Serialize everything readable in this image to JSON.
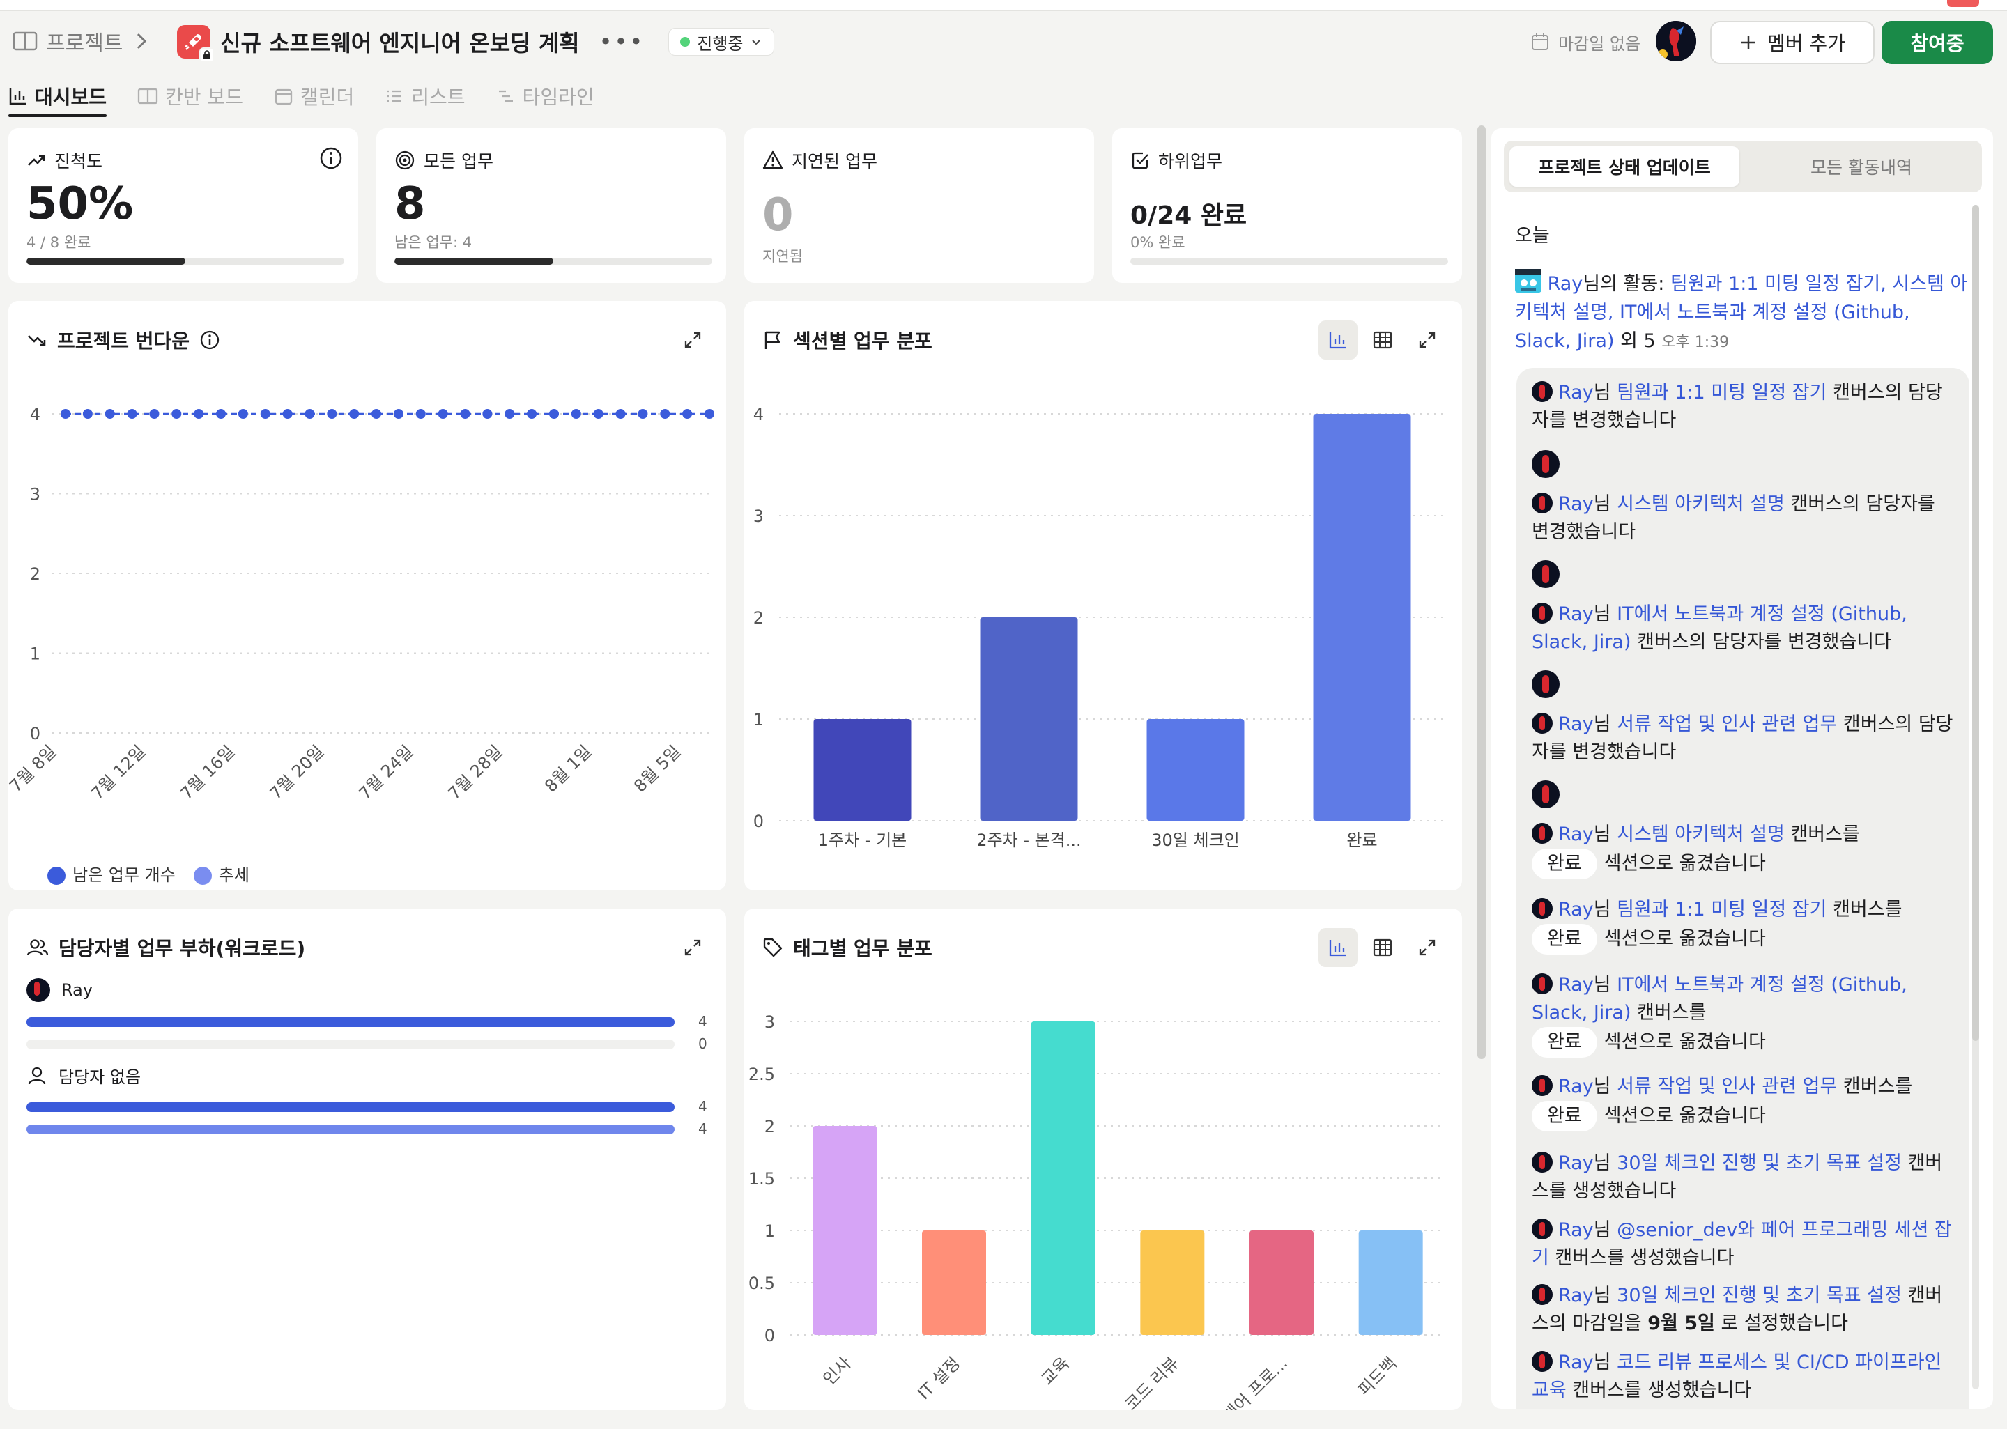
{
  "header": {
    "breadcrumb": "프로젝트",
    "title": "신규 소프트웨어 엔지니어 온보딩 계획",
    "status": "진행중",
    "due": "마감일 없음",
    "add_member": "멤버 추가",
    "join": "참여중"
  },
  "tabs": [
    {
      "label": "대시보드",
      "icon": "chart-icon"
    },
    {
      "label": "칸반 보드",
      "icon": "kanban-icon"
    },
    {
      "label": "캘린더",
      "icon": "calendar-icon"
    },
    {
      "label": "리스트",
      "icon": "list-icon"
    },
    {
      "label": "타임라인",
      "icon": "timeline-icon"
    }
  ],
  "stats": {
    "progress": {
      "title": "진척도",
      "value": "50%",
      "sub": "4 / 8 완료",
      "fraction": 0.5
    },
    "all_tasks": {
      "title": "모든 업무",
      "value": "8",
      "sub": "남은 업무: 4",
      "fraction": 0.5
    },
    "overdue": {
      "title": "지연된 업무",
      "value": "0",
      "sub": "지연됨"
    },
    "subtasks": {
      "title": "하위업무",
      "value": "0/24 완료",
      "sub": "0% 완료",
      "fraction": 0
    }
  },
  "burndown": {
    "title": "프로젝트 번다운",
    "legend": [
      "남은 업무 개수",
      "추세"
    ]
  },
  "section_chart": {
    "title": "섹션별 업무 분포"
  },
  "workload": {
    "title": "담당자별 업무 부하(워크로드)",
    "people": [
      {
        "name": "Ray",
        "a": "4",
        "b": "0",
        "fa": 1.0,
        "fb": 0
      },
      {
        "name": "담당자 없음",
        "a": "4",
        "b": "4",
        "fa": 1.0,
        "fb": 1.0
      }
    ]
  },
  "tag_chart": {
    "title": "태그별 업무 분포"
  },
  "chart_data": [
    {
      "type": "line",
      "x": [
        "7월 8일",
        "7월 12일",
        "7월 16일",
        "7월 20일",
        "7월 24일",
        "7월 28일",
        "8월 1일",
        "8월 5일"
      ],
      "series": [
        {
          "name": "남은 업무 개수",
          "values": [
            4,
            4,
            4,
            4,
            4,
            4,
            4,
            4,
            4,
            4,
            4,
            4,
            4,
            4,
            4,
            4,
            4,
            4,
            4,
            4,
            4,
            4,
            4,
            4,
            4,
            4,
            4,
            4,
            4,
            4
          ]
        }
      ],
      "yticks": [
        "0",
        "1",
        "2",
        "3",
        "4"
      ],
      "ylim": [
        0,
        4
      ]
    },
    {
      "type": "bar",
      "categories": [
        "1주차 - 기본",
        "2주차 - 본격...",
        "30일 체크인",
        "완료"
      ],
      "values": [
        1,
        2,
        1,
        4
      ],
      "colors": [
        "#4147b9",
        "#5064c8",
        "#5a78e8",
        "#5f7be6"
      ],
      "yticks": [
        "0",
        "1",
        "2",
        "3",
        "4"
      ],
      "ylim": [
        0,
        4
      ]
    },
    {
      "type": "bar",
      "categories": [
        "인사",
        "IT 설정",
        "교육",
        "코드 리뷰",
        "페어 프로...",
        "피드백"
      ],
      "values": [
        2,
        1,
        3,
        1,
        1,
        1
      ],
      "colors": [
        "#d6a4f6",
        "#ff8f78",
        "#45dccf",
        "#fbc64f",
        "#e56683",
        "#86c0f5"
      ],
      "yticks": [
        "0",
        "0.5",
        "1",
        "1.5",
        "2",
        "2.5",
        "3"
      ],
      "ylim": [
        0,
        3
      ]
    }
  ],
  "panel": {
    "tab_active": "프로젝트 상태 업데이트",
    "tab_other": "모든 활동내역",
    "today": "오늘",
    "head_user": "Ray",
    "head_mid": "님의 활동: ",
    "head_links": "팀원과 1:1 미팅 일정 잡기, 시스템 아키텍처 설명, IT에서 노트북과 계정 설정 (Github, Slack, Jira)",
    "head_more": " 외 5 ",
    "head_time": "오후 1:39",
    "events": [
      {
        "user": "Ray",
        "mid": "님 ",
        "link": "팀원과 1:1 미팅 일정 잡기",
        "rest": " 캔버스의 담당자를 변경했습니다"
      },
      {
        "user": "Ray",
        "mid": "님 ",
        "link": "시스템 아키텍처 설명",
        "rest": " 캔버스의 담당자를 변경했습니다"
      },
      {
        "user": "Ray",
        "mid": "님 ",
        "link": "IT에서 노트북과 계정 설정 (Github, Slack, Jira)",
        "rest": " 캔버스의 담당자를 변경했습니다"
      },
      {
        "user": "Ray",
        "mid": "님 ",
        "link": "서류 작업 및 인사 관련 업무",
        "rest": " 캔버스의 담당자를 변경했습니다"
      },
      {
        "user": "Ray",
        "mid": "님 ",
        "link": "시스템 아키텍처 설명",
        "rest": " 캔버스를",
        "pill": "완료",
        "after": "섹션으로 옮겼습니다"
      },
      {
        "user": "Ray",
        "mid": "님 ",
        "link": "팀원과 1:1 미팅 일정 잡기",
        "rest": " 캔버스를",
        "pill": "완료",
        "after": "섹션으로 옮겼습니다"
      },
      {
        "user": "Ray",
        "mid": "님 ",
        "link": "IT에서 노트북과 계정 설정 (Github, Slack, Jira)",
        "rest": " 캔버스를 ",
        "pill": "완료",
        "after": "섹션으로 옮겼습니다"
      },
      {
        "user": "Ray",
        "mid": "님 ",
        "link": "서류 작업 및 인사 관련 업무",
        "rest": " 캔버스를",
        "pill": "완료",
        "after": "섹션으로 옮겼습니다"
      },
      {
        "user": "Ray",
        "mid": "님 ",
        "link": "30일 체크인 진행 및 초기 목표 설정",
        "rest": " 캔버스를 생성했습니다"
      },
      {
        "user": "Ray",
        "mid": "님 ",
        "link": "@senior_dev와 페어 프로그래밍 세션 잡기",
        "rest": " 캔버스를 생성했습니다"
      },
      {
        "user": "Ray",
        "mid": "님 ",
        "link": "30일 체크인 진행 및 초기 목표 설정",
        "rest": " 캔버스의 마감일을 ",
        "bold": "9월 5일",
        "after2": " 로 설정했습니다"
      },
      {
        "user": "Ray",
        "mid": "님 ",
        "link": "코드 리뷰 프로세스 및 CI/CD 파이프라인 교육",
        "rest": " 캔버스를 생성했습니다"
      }
    ]
  }
}
